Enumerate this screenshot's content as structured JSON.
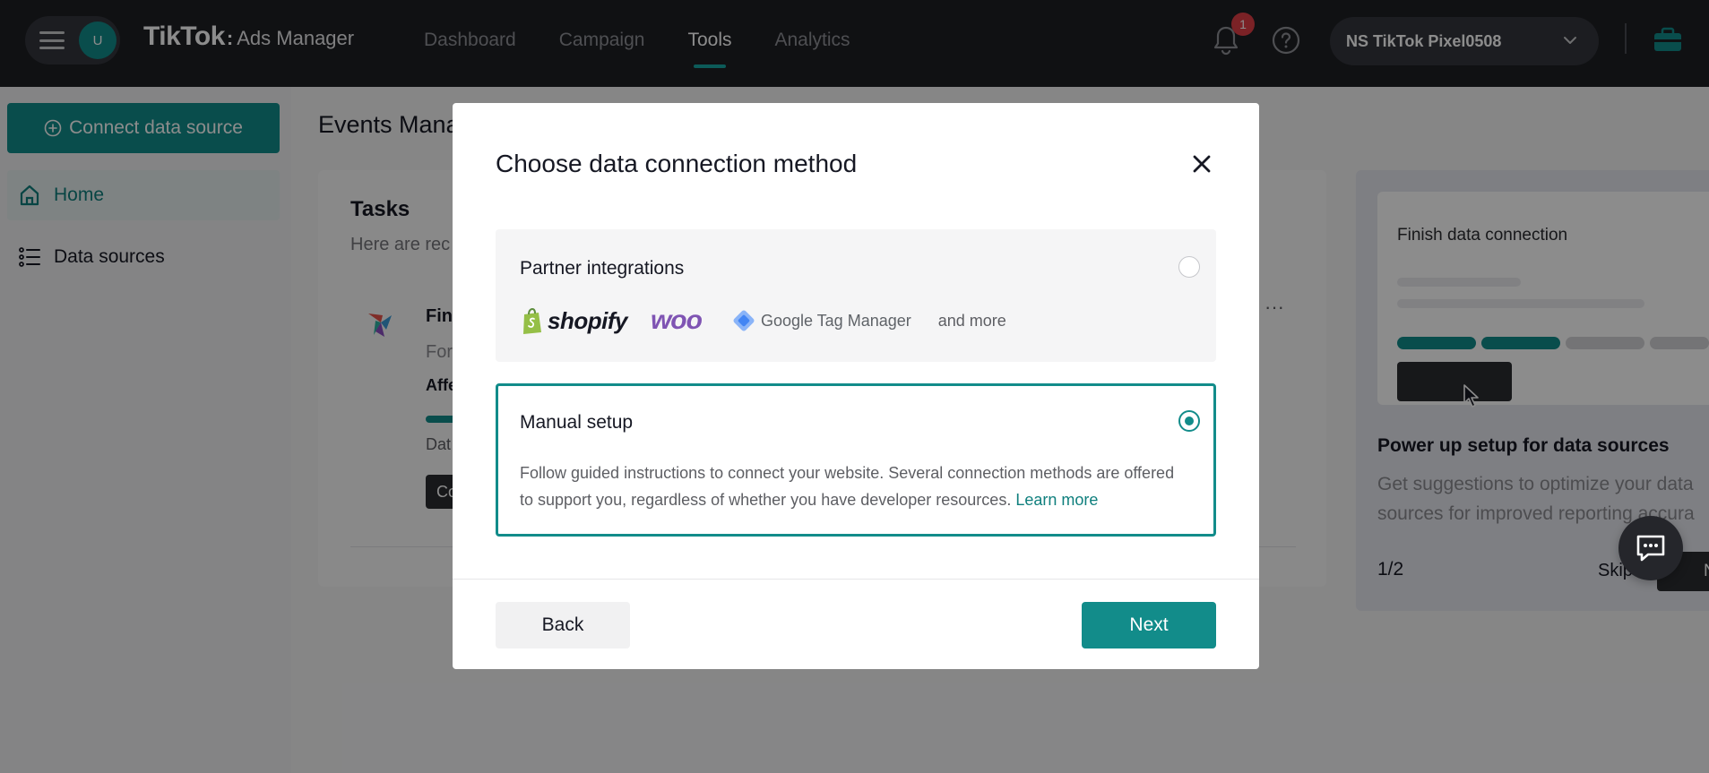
{
  "header": {
    "avatar_initial": "U",
    "logo_brand": "TikTok",
    "logo_colon": ":",
    "logo_product": "Ads Manager",
    "nav": [
      {
        "label": "Dashboard"
      },
      {
        "label": "Campaign"
      },
      {
        "label": "Tools",
        "active": true
      },
      {
        "label": "Analytics"
      }
    ],
    "notification_count": "1",
    "account_name": "NS TikTok Pixel0508"
  },
  "sidebar": {
    "connect_label": "Connect data source",
    "items": [
      {
        "label": "Home",
        "icon": "home-icon",
        "active": true
      },
      {
        "label": "Data sources",
        "icon": "list-icon"
      }
    ]
  },
  "main": {
    "title": "Events Mana",
    "tasks": {
      "title": "Tasks",
      "subtitle": "Here are rec",
      "item_title": "Fin",
      "item_desc": "For",
      "item_affected": "Affe",
      "item_date": "Dat",
      "item_button": "Co",
      "more": "···"
    }
  },
  "guide": {
    "preview_title": "Finish data connection",
    "title": "Power up setup for data sources",
    "description": "Get suggestions to optimize your data sources for improved reporting accura",
    "step": "1/2",
    "skip_label": "Skip",
    "next_label": "Ne",
    "progress_filled": 2,
    "progress_total": 4
  },
  "modal": {
    "title": "Choose data connection method",
    "options": [
      {
        "id": "partner",
        "title": "Partner integrations",
        "selected": false,
        "logos": [
          "shopify",
          "woo",
          "Google Tag Manager"
        ],
        "more": "and more"
      },
      {
        "id": "manual",
        "title": "Manual setup",
        "selected": true,
        "description": "Follow guided instructions to connect your website. Several connection methods are offered to support you, regardless of whether you have developer resources.",
        "link": "Learn more"
      }
    ],
    "back_label": "Back",
    "next_label": "Next"
  },
  "colors": {
    "accent": "#128c8a",
    "topbar": "#1e1f24",
    "badge": "#e03e46",
    "woo": "#7f54b3"
  }
}
